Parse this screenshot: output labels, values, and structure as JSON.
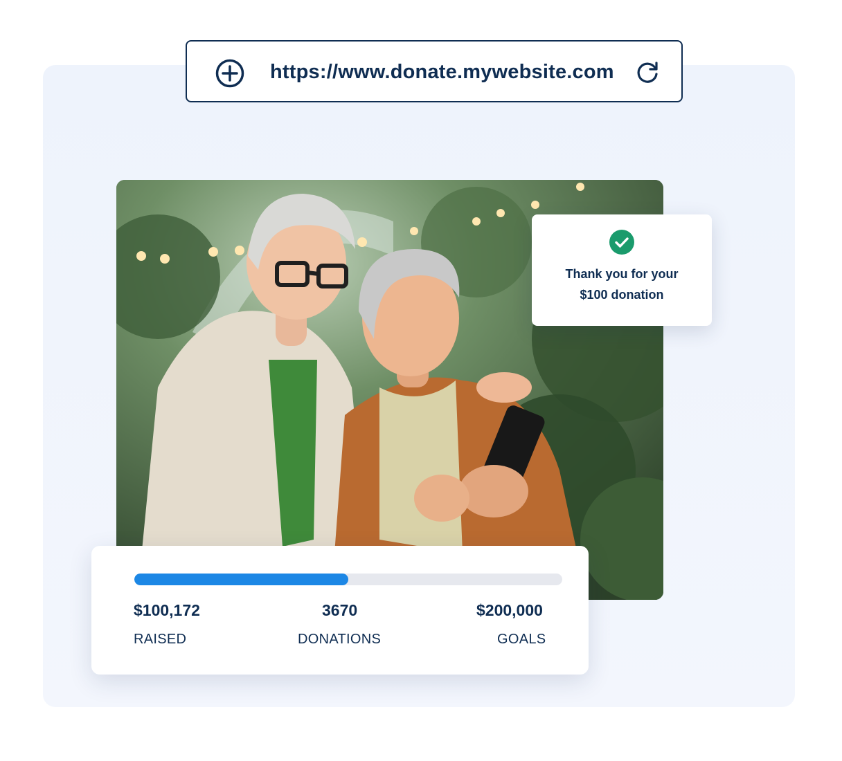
{
  "address_bar": {
    "url": "https://www.donate.mywebsite.com",
    "add_icon": "plus-circle-icon",
    "reload_icon": "reload-icon"
  },
  "notification": {
    "icon": "check-circle-icon",
    "line1": "Thank you for your",
    "line2": "$100 donation",
    "accent_color": "#1a9b6c"
  },
  "campaign": {
    "progress_fraction": 0.5,
    "progress_color": "#1c87e5",
    "raised_value": "$100,172",
    "raised_label": "RAISED",
    "donations_value": "3670",
    "donations_label": "DONATIONS",
    "goal_value": "$200,000",
    "goal_label": "GOALS"
  }
}
